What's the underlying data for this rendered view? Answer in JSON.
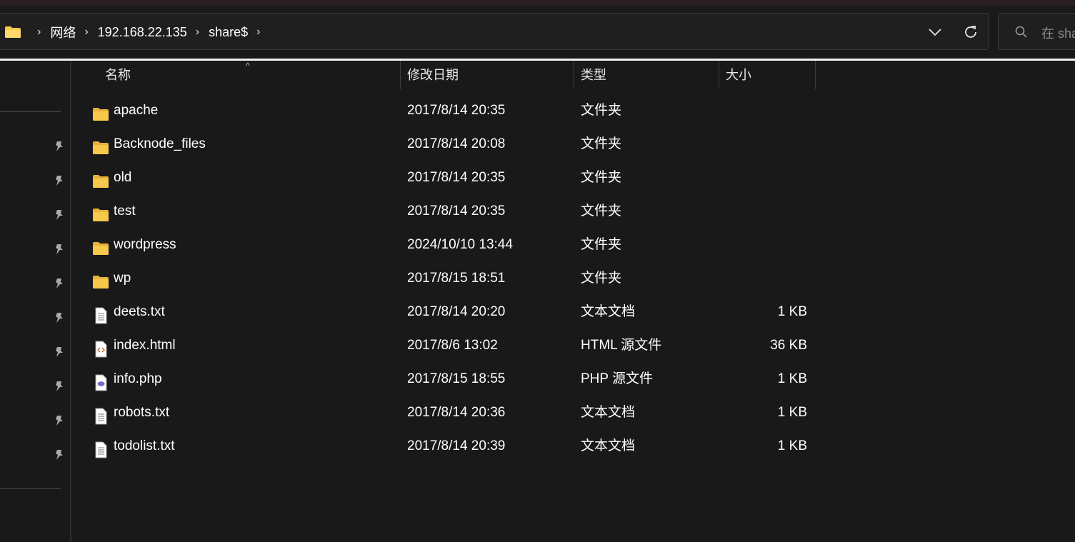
{
  "address_bar": {
    "crumbs": [
      "网络",
      "192.168.22.135",
      "share$"
    ],
    "expand_icon": "chevron-down-icon",
    "refresh_icon": "refresh-icon"
  },
  "search": {
    "placeholder": "在 sha"
  },
  "columns": {
    "name": "名称",
    "date": "修改日期",
    "type": "类型",
    "size": "大小"
  },
  "files": [
    {
      "name": "apache",
      "date": "2017/8/14 20:35",
      "type": "文件夹",
      "size": "",
      "icon": "folder-icon"
    },
    {
      "name": "Backnode_files",
      "date": "2017/8/14 20:08",
      "type": "文件夹",
      "size": "",
      "icon": "folder-icon"
    },
    {
      "name": "old",
      "date": "2017/8/14 20:35",
      "type": "文件夹",
      "size": "",
      "icon": "folder-icon"
    },
    {
      "name": "test",
      "date": "2017/8/14 20:35",
      "type": "文件夹",
      "size": "",
      "icon": "folder-icon"
    },
    {
      "name": "wordpress",
      "date": "2024/10/10 13:44",
      "type": "文件夹",
      "size": "",
      "icon": "folder-icon"
    },
    {
      "name": "wp",
      "date": "2017/8/15 18:51",
      "type": "文件夹",
      "size": "",
      "icon": "folder-icon"
    },
    {
      "name": "deets.txt",
      "date": "2017/8/14 20:20",
      "type": "文本文档",
      "size": "1 KB",
      "icon": "text-file-icon"
    },
    {
      "name": "index.html",
      "date": "2017/8/6 13:02",
      "type": "HTML 源文件",
      "size": "36 KB",
      "icon": "html-file-icon"
    },
    {
      "name": "info.php",
      "date": "2017/8/15 18:55",
      "type": "PHP 源文件",
      "size": "1 KB",
      "icon": "php-file-icon"
    },
    {
      "name": "robots.txt",
      "date": "2017/8/14 20:36",
      "type": "文本文档",
      "size": "1 KB",
      "icon": "text-file-icon"
    },
    {
      "name": "todolist.txt",
      "date": "2017/8/14 20:39",
      "type": "文本文档",
      "size": "1 KB",
      "icon": "text-file-icon"
    }
  ],
  "colors": {
    "background": "#191919",
    "folder": "#f6c84c",
    "text": "#ffffff"
  }
}
